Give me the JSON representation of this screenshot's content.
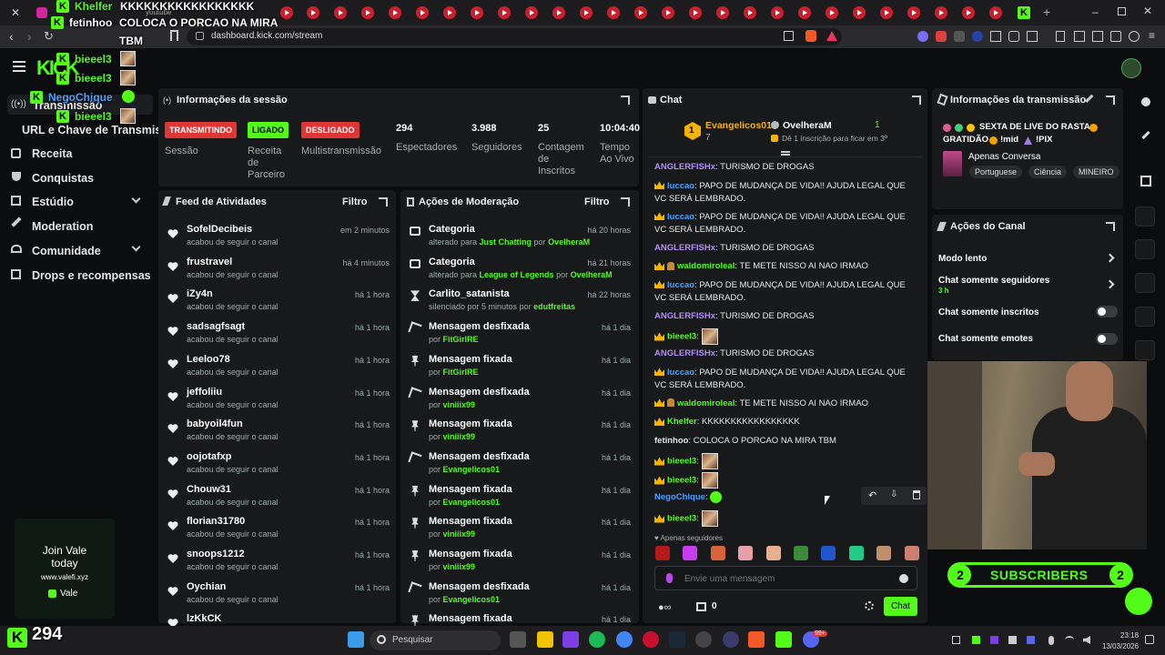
{
  "browser": {
    "tab_youtube_label": "youtube",
    "url": "dashboard.kick.com/stream"
  },
  "overlay": {
    "line1_user": "Khelfer",
    "line1_msg": "KKKKKKKKKKKKKKKKK",
    "line2_user": "fetinhoo",
    "line2_msg": "COLOCA O PORCAO NA MIRA",
    "line2_msg_cont": "TBM",
    "line3_user": "bieeel3",
    "line4_user": "bieeel3",
    "line5_user": "NegoChique",
    "line6_user": "bieeel3",
    "brand_logo": "KICK"
  },
  "sidebar": {
    "items": [
      {
        "label": "Transmissão"
      },
      {
        "label": "URL e Chave de Transmissão"
      },
      {
        "label": "Receita"
      },
      {
        "label": "Conquistas"
      },
      {
        "label": "Estúdio"
      },
      {
        "label": "Moderation"
      },
      {
        "label": "Comunidade"
      },
      {
        "label": "Drops e recompensas"
      }
    ],
    "promo": {
      "title": "Join Vale",
      "title2": "today",
      "url": "www.valefi.xyz",
      "brand": "Vale"
    },
    "viewer_count": "294"
  },
  "session": {
    "title": "Informações da sessão",
    "badges": [
      "TRANSMITINDO",
      "LIGADO",
      "DESLIGADO"
    ],
    "labels": [
      "Sessão",
      "Receita de Parceiro",
      "Multistransmissão"
    ],
    "stats": [
      {
        "value": "294",
        "label": "Espectadores"
      },
      {
        "value": "3.988",
        "label": "Seguidores"
      },
      {
        "value": "25",
        "label": "Contagem de Inscritos"
      },
      {
        "value": "10:04:40",
        "label": "Tempo Ao Vivo"
      }
    ]
  },
  "feed": {
    "title": "Feed de Atividades",
    "filter": "Filtro",
    "items": [
      {
        "name": "SofelDecibeis",
        "sub": "acabou de seguir o canal",
        "time": "em 2 minutos"
      },
      {
        "name": "frustravel",
        "sub": "acabou de seguir o canal",
        "time": "há 4 minutos"
      },
      {
        "name": "iZy4n",
        "sub": "acabou de seguir o canal",
        "time": "há 1 hora"
      },
      {
        "name": "sadsagfsagt",
        "sub": "acabou de seguir o canal",
        "time": "há 1 hora"
      },
      {
        "name": "Leeloo78",
        "sub": "acabou de seguir o canal",
        "time": "há 1 hora"
      },
      {
        "name": "jeffoliiu",
        "sub": "acabou de seguir o canal",
        "time": "há 1 hora"
      },
      {
        "name": "babyoil4fun",
        "sub": "acabou de seguir o canal",
        "time": "há 1 hora"
      },
      {
        "name": "oojotafxp",
        "sub": "acabou de seguir o canal",
        "time": "há 1 hora"
      },
      {
        "name": "Chouw31",
        "sub": "acabou de seguir o canal",
        "time": "há 1 hora"
      },
      {
        "name": "florian31780",
        "sub": "acabou de seguir o canal",
        "time": "há 1 hora"
      },
      {
        "name": "snoops1212",
        "sub": "acabou de seguir o canal",
        "time": "há 1 hora"
      },
      {
        "name": "Oychian",
        "sub": "acabou de seguir o canal",
        "time": "há 1 hora"
      },
      {
        "name": "lzKkCK",
        "sub": "",
        "time": ""
      }
    ]
  },
  "moderation": {
    "title": "Ações de Moderação",
    "filter": "Filtro",
    "items": [
      {
        "action": "Categoria",
        "pre": "alterado para ",
        "target": "Just Chatting",
        "mid": " por ",
        "by": "OvelheraM",
        "time": "há 20 horas"
      },
      {
        "action": "Categoria",
        "pre": "alterado para ",
        "target": "League of Legends",
        "mid": " por ",
        "by": "OvelheraM",
        "time": "há 21 horas"
      },
      {
        "action": "Carlito_satanista",
        "pre": "silenciado por 5 minutos por ",
        "target": "",
        "mid": "",
        "by": "edutfreitas",
        "time": "há 22 horas"
      },
      {
        "action": "Mensagem desfixada",
        "pre": "por ",
        "target": "",
        "mid": "",
        "by": "FitGirlRE",
        "time": "há 1 dia"
      },
      {
        "action": "Mensagem fixada",
        "pre": "por ",
        "target": "",
        "mid": "",
        "by": "FitGirlRE",
        "time": "há 1 dia"
      },
      {
        "action": "Mensagem desfixada",
        "pre": "por ",
        "target": "",
        "mid": "",
        "by": "viniiix99",
        "time": "há 1 dia"
      },
      {
        "action": "Mensagem fixada",
        "pre": "por ",
        "target": "",
        "mid": "",
        "by": "viniiix99",
        "time": "há 1 dia"
      },
      {
        "action": "Mensagem desfixada",
        "pre": "por ",
        "target": "",
        "mid": "",
        "by": "Evangelicos01",
        "time": "há 1 dia"
      },
      {
        "action": "Mensagem fixada",
        "pre": "por ",
        "target": "",
        "mid": "",
        "by": "Evangelicos01",
        "time": "há 1 dia"
      },
      {
        "action": "Mensagem fixada",
        "pre": "por ",
        "target": "",
        "mid": "",
        "by": "viniiix99",
        "time": "há 1 dia"
      },
      {
        "action": "Mensagem fixada",
        "pre": "por ",
        "target": "",
        "mid": "",
        "by": "viniiix99",
        "time": "há 1 dia"
      },
      {
        "action": "Mensagem desfixada",
        "pre": "por ",
        "target": "",
        "mid": "",
        "by": "Evangelicos01",
        "time": "há 1 dia"
      },
      {
        "action": "Mensagem fixada",
        "pre": "",
        "target": "",
        "mid": "",
        "by": "",
        "time": "há 1 dia"
      }
    ]
  },
  "chat": {
    "title": "Chat",
    "top_gifter": {
      "rank": "1",
      "name": "Evangelicos01",
      "count": "7"
    },
    "second": {
      "name": "OvelheraM",
      "count": "1",
      "hint": "Dê 1 inscrição para ficar em 3º"
    },
    "messages": [
      {
        "user": "ANGLERFISHx",
        "color": "#b48cff",
        "crown": false,
        "text": "TURISMO DE DROGAS"
      },
      {
        "user": "luccao",
        "color": "#4aa3ff",
        "crown": true,
        "text": "PAPO DE MUDANÇA DE VIDA!! AJUDA LEGAL QUE VC SERÁ LEMBRADO."
      },
      {
        "user": "luccao",
        "color": "#4aa3ff",
        "crown": true,
        "text": "PAPO DE MUDANÇA DE VIDA!! AJUDA LEGAL QUE VC SERÁ LEMBRADO."
      },
      {
        "user": "ANGLERFISHx",
        "color": "#b48cff",
        "crown": false,
        "text": "TURISMO DE DROGAS"
      },
      {
        "user": "waldomiroleal",
        "color": "#53fc18",
        "crown": true,
        "text": "TE METE NISSO AI NAO IRMAO"
      },
      {
        "user": "luccao",
        "color": "#4aa3ff",
        "crown": true,
        "text": "PAPO DE MUDANÇA DE VIDA!! AJUDA LEGAL QUE VC SERÁ LEMBRADO."
      },
      {
        "user": "ANGLERFISHx",
        "color": "#b48cff",
        "crown": false,
        "text": "TURISMO DE DROGAS"
      },
      {
        "user": "bieeel3",
        "color": "#53fc18",
        "crown": true,
        "text": ""
      },
      {
        "user": "ANGLERFISHx",
        "color": "#b48cff",
        "crown": false,
        "text": "TURISMO DE DROGAS"
      },
      {
        "user": "luccao",
        "color": "#4aa3ff",
        "crown": true,
        "text": "PAPO DE MUDANÇA DE VIDA!! AJUDA LEGAL QUE VC SERÁ LEMBRADO."
      },
      {
        "user": "waldomiroleal",
        "color": "#53fc18",
        "crown": true,
        "text": "TE METE NISSO AI NAO IRMAO"
      },
      {
        "user": "Khelfer",
        "color": "#53fc18",
        "crown": true,
        "text": "KKKKKKKKKKKKKKKKK"
      },
      {
        "user": "fetinhoo",
        "color": "#e6e6e6",
        "crown": false,
        "text": "COLOCA O PORCAO NA MIRA TBM"
      },
      {
        "user": "bieeel3",
        "color": "#53fc18",
        "crown": true,
        "text": ""
      },
      {
        "user": "bieeel3",
        "color": "#53fc18",
        "crown": true,
        "text": ""
      },
      {
        "user": "NegoChique",
        "color": "#4aa3ff",
        "crown": false,
        "text": ""
      },
      {
        "user": "bieeel3",
        "color": "#53fc18",
        "crown": true,
        "text": ""
      }
    ],
    "followers_only": "Apenas seguidores",
    "placeholder": "Envie uma mensagem",
    "viewers_count": "0",
    "send_label": "Chat"
  },
  "stream_info": {
    "title": "Informações da transmissão",
    "stream_title_1": "SEXTA DE LIVE DO RASTA",
    "stream_title_2": "GRATIDÃO",
    "stream_title_3": "!mid",
    "stream_title_4": "!PIX",
    "category": "Apenas Conversa",
    "tags": [
      "Portuguese",
      "Ciência",
      "MINEIRO"
    ]
  },
  "channel_actions": {
    "title": "Ações do Canal",
    "items": [
      {
        "label": "Modo lento"
      },
      {
        "label": "Chat somente seguidores",
        "sub": "3 h"
      },
      {
        "label": "Chat somente inscritos"
      },
      {
        "label": "Chat somente emotes"
      }
    ]
  },
  "subscribers_banner": {
    "left": "2",
    "label": "SUBSCRIBERS",
    "right": "2"
  },
  "taskbar": {
    "search": "Pesquisar",
    "time": "23:18",
    "date": "13/03/2026",
    "notif": "99+"
  },
  "colors": {
    "brand": "#53fc18",
    "live": "#e03535",
    "panel": "#18191b",
    "bg": "#0b0c0d"
  }
}
